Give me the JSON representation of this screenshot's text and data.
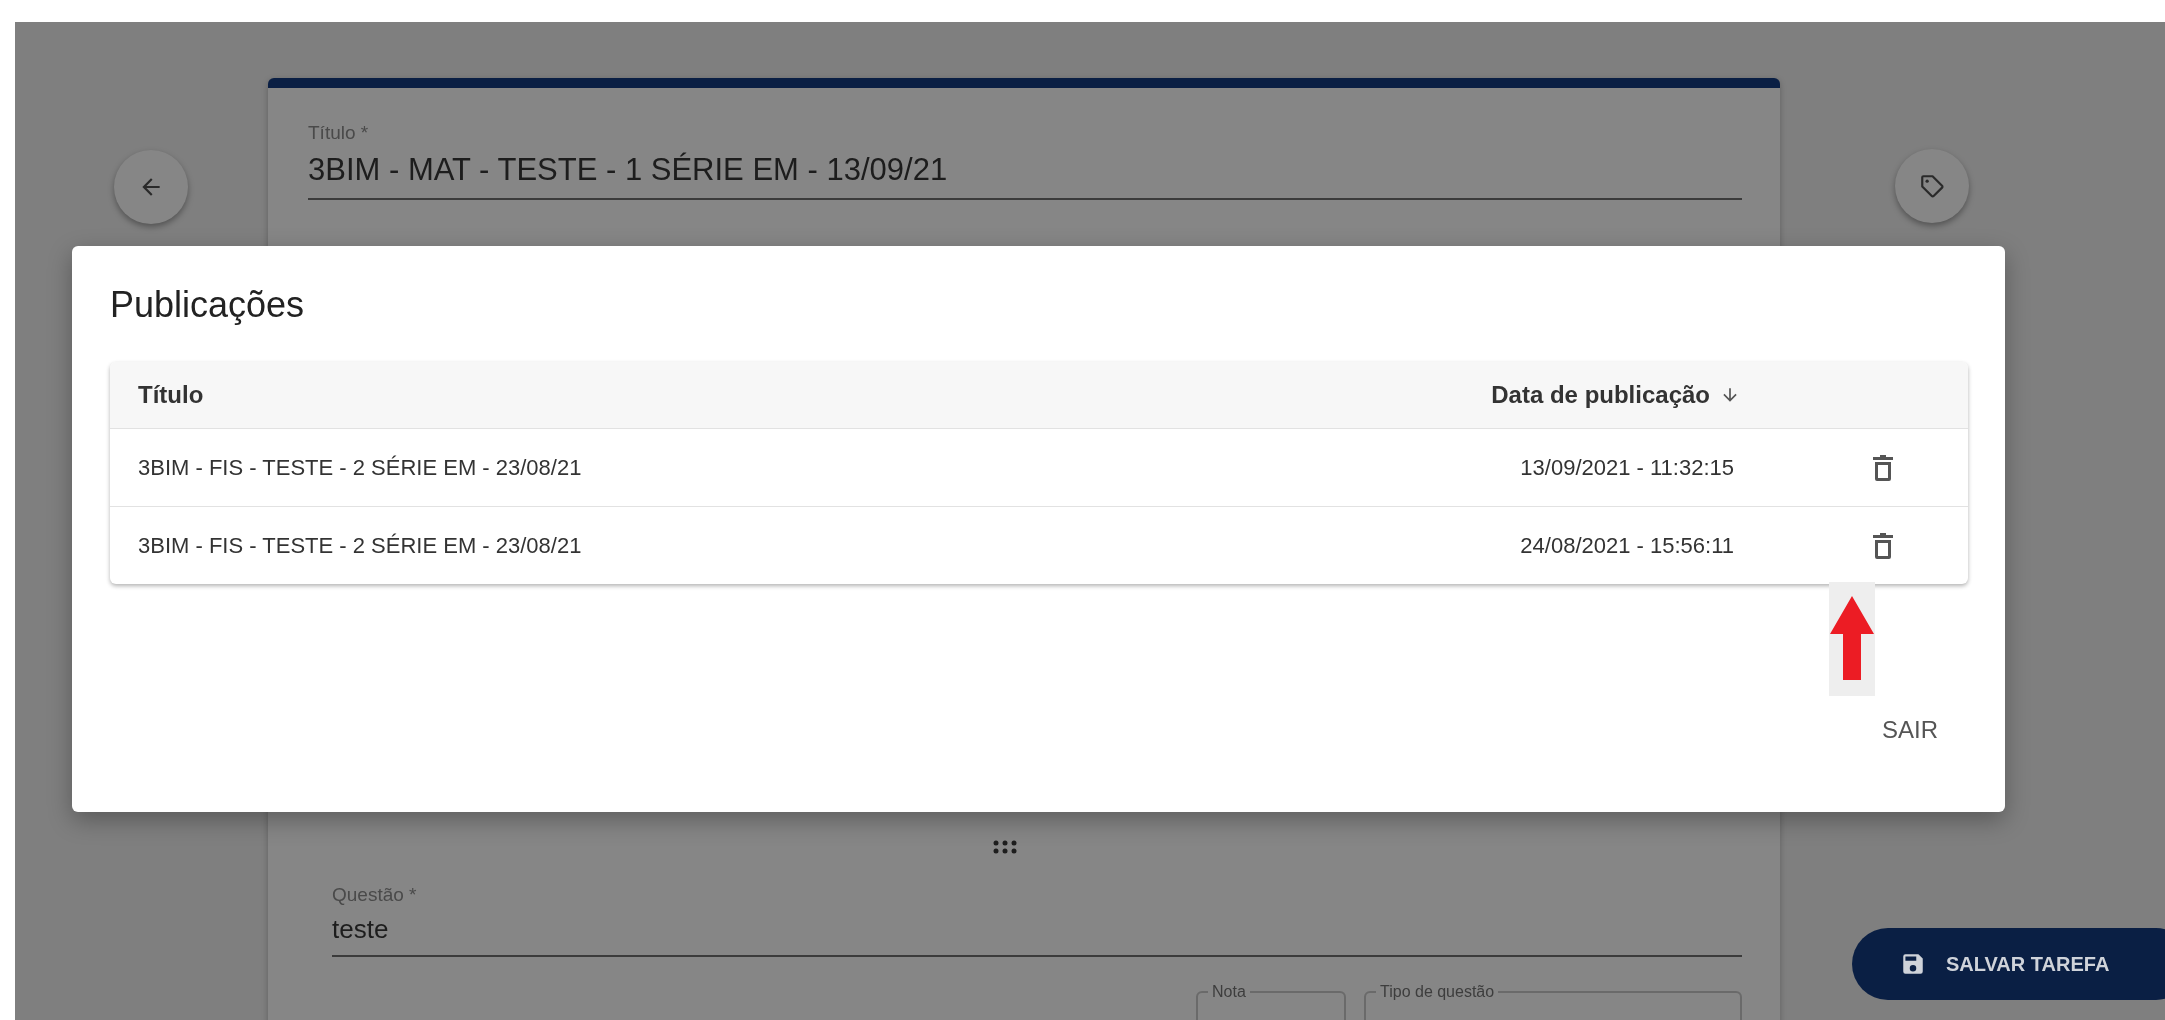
{
  "form": {
    "title_field": {
      "label": "Título *",
      "value": "3BIM - MAT - TESTE - 1 SÉRIE EM - 13/09/21"
    },
    "question_field": {
      "label": "Questão *",
      "value": "teste"
    },
    "score_field": {
      "label": "Nota"
    },
    "question_type_field": {
      "label": "Tipo de questão"
    }
  },
  "save_button": "SALVAR TAREFA",
  "dialog": {
    "title": "Publicações",
    "table": {
      "columns": [
        {
          "label": "Título",
          "sorted": false
        },
        {
          "label": "Data de publicação",
          "sorted": true
        }
      ],
      "rows": [
        {
          "title": "3BIM - FIS - TESTE - 2 SÉRIE EM - 23/08/21",
          "date": "13/09/2021 - 11:32:15"
        },
        {
          "title": "3BIM - FIS - TESTE - 2 SÉRIE EM - 23/08/21",
          "date": "24/08/2021 - 15:56:11"
        }
      ]
    },
    "exit_button": "SAIR"
  }
}
